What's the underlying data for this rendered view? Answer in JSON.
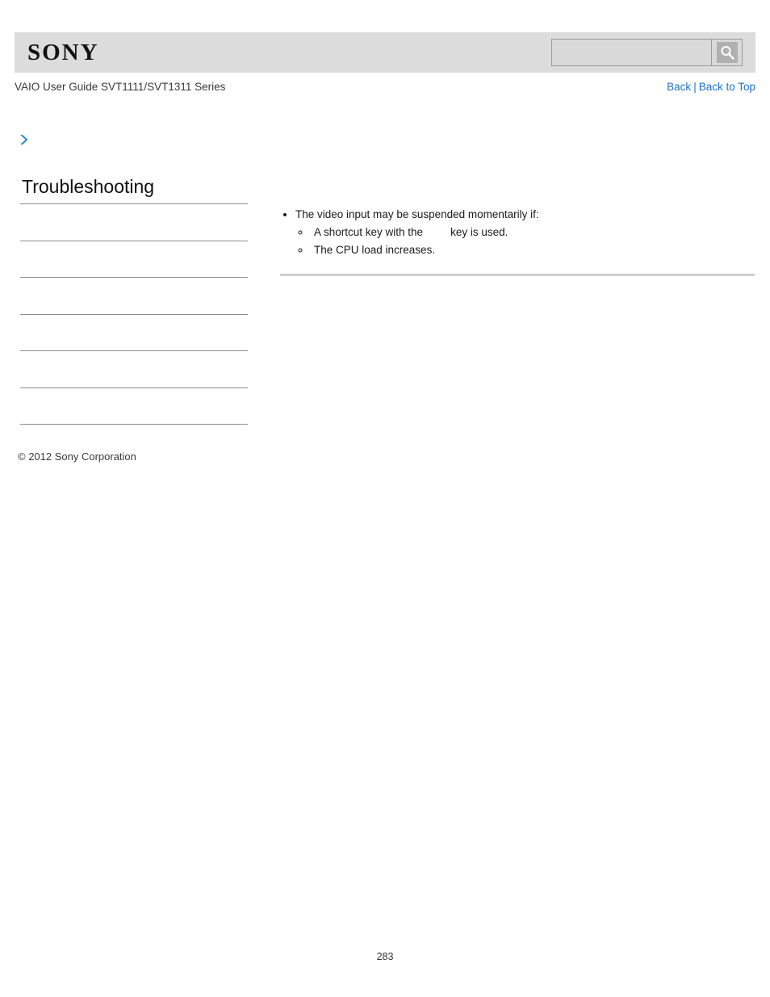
{
  "header": {
    "brand": "SONY",
    "brand_icon": "sony-wordmark"
  },
  "search": {
    "value": "",
    "placeholder": "",
    "button_icon": "search-magnifier-icon",
    "button_label": ""
  },
  "subheader": {
    "doc_title": "VAIO User Guide SVT1111/SVT1311 Series",
    "back_label": "Back",
    "separator": "|",
    "back_to_top_label": "Back to Top"
  },
  "breadcrumb": {
    "arrow_icon": "blue-chevron-right-icon",
    "text": ""
  },
  "sidebar": {
    "heading": "Troubleshooting",
    "items": [
      {
        "label": ""
      },
      {
        "label": ""
      },
      {
        "label": ""
      },
      {
        "label": ""
      },
      {
        "label": ""
      },
      {
        "label": ""
      },
      {
        "label": ""
      }
    ]
  },
  "content": {
    "bullets": [
      {
        "text": "The video input may be suspended momentarily if:",
        "sub": [
          {
            "before": "A shortcut key with the",
            "missing_image": true,
            "after": "key is used."
          },
          {
            "before": "The CPU load increases.",
            "missing_image": false,
            "after": ""
          }
        ]
      }
    ]
  },
  "footer": {
    "copyright": "© 2012 Sony Corporation",
    "page_number": "283"
  },
  "colors": {
    "header_bg": "#dcdcdc",
    "link_blue": "#1d72c4",
    "rule_gray": "#8e8e8e",
    "content_rule": "#cfcfcf"
  }
}
